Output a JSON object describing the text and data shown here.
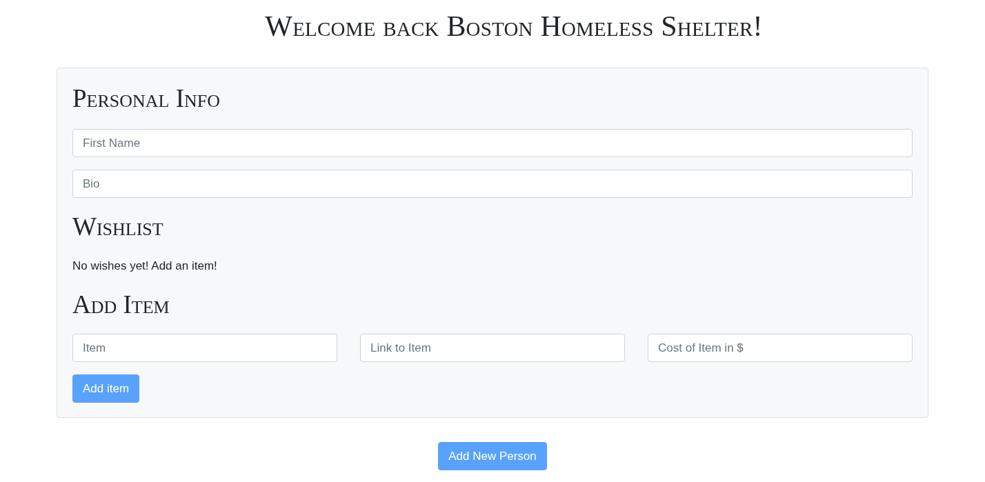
{
  "title": "Welcome back Boston Homeless Shelter!",
  "personal_info": {
    "heading": "Personal Info",
    "fields": [
      {
        "placeholder": "First Name"
      },
      {
        "placeholder": "Bio"
      }
    ]
  },
  "wishlist": {
    "heading": "Wishlist",
    "empty_message": "No wishes yet! Add an item!"
  },
  "add_item": {
    "heading": "Add Item",
    "fields": [
      {
        "placeholder": "Item"
      },
      {
        "placeholder": "Link to Item"
      },
      {
        "placeholder": "Cost of Item in $"
      }
    ],
    "button": "Add item"
  },
  "add_person_button": "Add New Person"
}
